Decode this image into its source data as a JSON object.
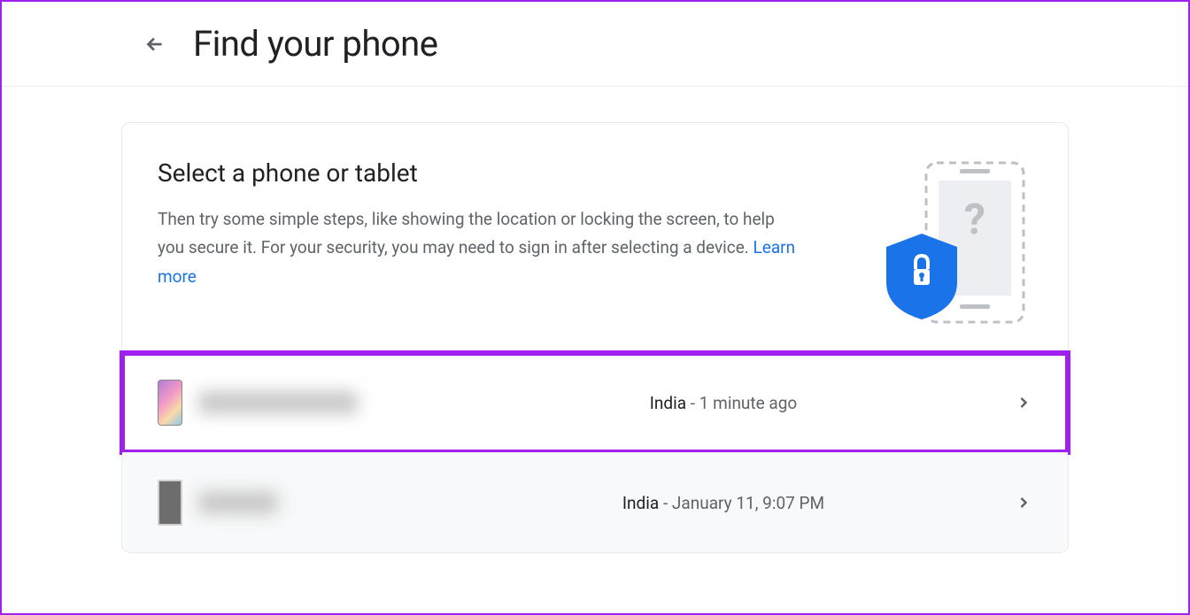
{
  "header": {
    "title": "Find your phone"
  },
  "card": {
    "title": "Select a phone or tablet",
    "description_pre": "Then try some simple steps, like showing the location or locking the screen, to help you secure it. For your security, you may need to sign in after selecting a device. ",
    "learn_more": "Learn more"
  },
  "devices": [
    {
      "location": "India",
      "separator": " - ",
      "time": "1 minute ago"
    },
    {
      "location": "India",
      "separator": " - ",
      "time": "January 11, 9:07 PM"
    }
  ]
}
